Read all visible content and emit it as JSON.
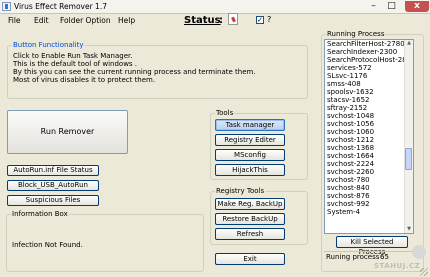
{
  "window": {
    "title": "Virus Effect Remover 1.7",
    "min_glyph": "–",
    "max_glyph": "□",
    "close_glyph": "x"
  },
  "menu": {
    "items": [
      "File",
      "Edit",
      "Folder Option",
      "Help"
    ]
  },
  "status": {
    "label": "Status",
    "colon": ":",
    "checkbox_label": "?",
    "checkbox_checked": true,
    "checkbox_glyph": "✓"
  },
  "button_functionality": {
    "legend": "Button Functionality",
    "lines": [
      "Click to Enable  Run Task Manager.",
      "This is the default tool of windows .",
      "By this you can see the current running process and terminate them.",
      "Most of virus disables it to protect them."
    ]
  },
  "main_buttons": {
    "run_remover": "Run Remover",
    "autorun_status": "AutoRun.inf File Status",
    "block_usb": "Block_USB_AutoRun",
    "suspicious": "Suspicious Files"
  },
  "info_box": {
    "legend": "Information Box",
    "message": "Infection Not Found."
  },
  "tools": {
    "legend": "Tools",
    "buttons": [
      "Task manager",
      "Registry Editer",
      "MSconfig",
      "HijackThis"
    ]
  },
  "registry_tools": {
    "legend": "Registry Tools",
    "buttons": [
      "Make Reg. BackUp",
      "Restore BackUp",
      "Refresh"
    ]
  },
  "exit_label": "Exit",
  "running_process": {
    "legend": "Running Process",
    "items": [
      "SearchFilterHost-2780",
      "SearchIndexer-2300",
      "SearchProtocolHost-288",
      "services-572",
      "SLsvc-1176",
      "smss-408",
      "spoolsv-1632",
      "stacsv-1652",
      "sftray-2152",
      "svchost-1048",
      "svchost-1056",
      "svchost-1060",
      "svchost-1212",
      "svchost-1368",
      "svchost-1664",
      "svchost-2224",
      "svchost-2260",
      "svchost-780",
      "svchost-840",
      "svchost-876",
      "svchost-992",
      "System-4"
    ],
    "kill_label": "Kill Selected Process",
    "count_label": "Runing process :",
    "count_value": "65"
  },
  "watermark": "STAHUJ.CZ",
  "colors": {
    "background": "#ece9d8",
    "legend_blue": "#0046d5",
    "close_red": "#c75050",
    "hot_button": "#b7cfee"
  }
}
